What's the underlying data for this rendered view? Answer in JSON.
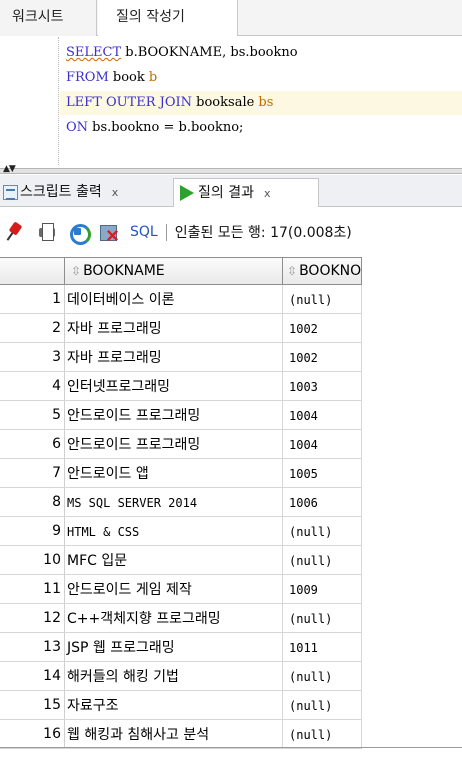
{
  "tabs": {
    "worksheet": "워크시트",
    "query_builder": "질의 작성기"
  },
  "editor": {
    "lines": [
      [
        {
          "t": "SELECT",
          "c": "kw squiggle"
        },
        {
          "t": " b.BOOKNAME, bs.bookno",
          "c": ""
        }
      ],
      [
        {
          "t": "FROM",
          "c": "kw"
        },
        {
          "t": " book ",
          "c": ""
        },
        {
          "t": "b",
          "c": "al"
        }
      ],
      [
        {
          "t": "LEFT OUTER JOIN",
          "c": "kw"
        },
        {
          "t": " booksale ",
          "c": ""
        },
        {
          "t": "bs",
          "c": "al"
        }
      ],
      [
        {
          "t": "ON",
          "c": "kw"
        },
        {
          "t": " bs.bookno = b.bookno;",
          "c": ""
        }
      ]
    ]
  },
  "output_tabs": {
    "script_output": "스크립트 출력",
    "query_result": "질의 결과",
    "close": "x"
  },
  "result_toolbar": {
    "sql": "SQL",
    "status": "인출된 모든 행: 17(0.008초)"
  },
  "grid": {
    "columns": [
      "BOOKNAME",
      "BOOKNO"
    ],
    "rows": [
      [
        "1",
        "데이터베이스 이론",
        "(null)",
        false
      ],
      [
        "2",
        "자바 프로그래밍",
        "1002",
        false
      ],
      [
        "3",
        "자바 프로그래밍",
        "1002",
        false
      ],
      [
        "4",
        "인터넷프로그래밍",
        "1003",
        false
      ],
      [
        "5",
        "안드로이드 프로그래밍",
        "1004",
        false
      ],
      [
        "6",
        "안드로이드 프로그래밍",
        "1004",
        false
      ],
      [
        "7",
        "안드로이드 앱",
        "1005",
        false
      ],
      [
        "8",
        "MS SQL SERVER 2014",
        "1006",
        true
      ],
      [
        "9",
        "HTML & CSS",
        "(null)",
        true
      ],
      [
        "10",
        "MFC 입문",
        "(null)",
        false
      ],
      [
        "11",
        "안드로이드 게임 제작",
        "1009",
        false
      ],
      [
        "12",
        "C++객체지향 프로그래밍",
        "(null)",
        false
      ],
      [
        "13",
        "JSP 웹 프로그래밍",
        "1011",
        false
      ],
      [
        "14",
        "해커들의 해킹 기법",
        "(null)",
        false
      ],
      [
        "15",
        "자료구조",
        "(null)",
        false
      ],
      [
        "16",
        "웹 해킹과 침해사고 분석",
        "(null)",
        false
      ]
    ]
  }
}
